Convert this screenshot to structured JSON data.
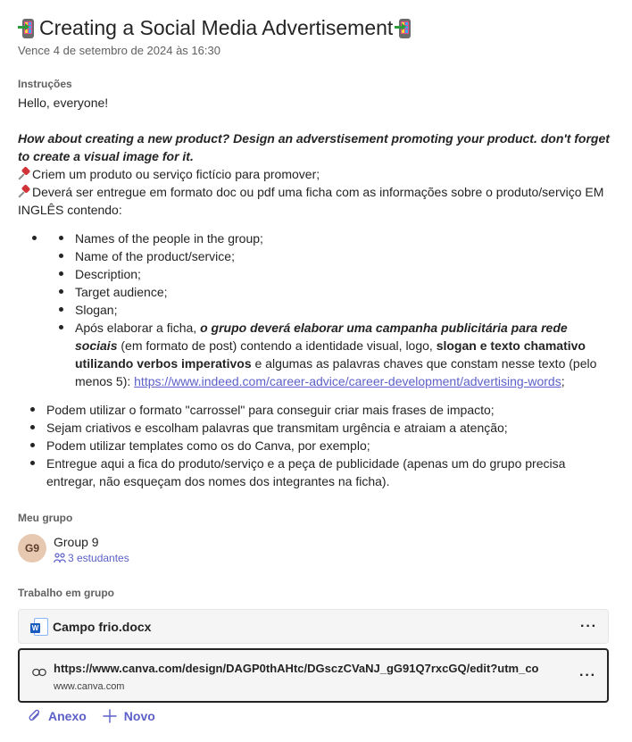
{
  "assignment": {
    "title": "Creating a Social Media Advertisement",
    "due": "Vence 4 de setembro de 2024 às 16:30"
  },
  "instructions": {
    "label": "Instruções",
    "greeting": "Hello, everyone!",
    "prompt": "How about creating a new product? Design an adverstisement promoting your product.  don't forget to create a visual image for it.",
    "pin1": "Criem um produto ou serviço fictício para promover;",
    "pin2": "Deverá ser entregue em formato doc ou pdf uma ficha com as informações sobre o produto/serviço EM INGLÊS contendo:",
    "inner_items": [
      "Names of the people in the group;",
      "Name of the product/service;",
      "Description;",
      "Target audience;",
      "Slogan;"
    ],
    "campaign": {
      "t1": "Após elaborar a ficha, ",
      "t2": "o grupo deverá elaborar uma campanha publicitária para rede sociais",
      "t3": " (em formato de post) contendo a identidade visual, logo, ",
      "t4": "slogan e texto chamativo utilizando verbos imperativos",
      "t5": " e algumas as palavras chaves que constam nesse texto (pelo menos 5): ",
      "link": "https://www.indeed.com/career-advice/career-development/advertising-words",
      "t6": ";"
    },
    "outer_items": [
      "Podem utilizar o formato \"carrossel\" para conseguir criar mais frases de impacto;",
      "Sejam criativos e escolham palavras que transmitam urgência e atraiam a atenção;",
      "Podem utilizar templates como os do Canva, por exemplo;",
      "Entregue aqui a fica do produto/serviço e a peça de publicidade (apenas um do grupo precisa entregar, não esqueçam dos nomes dos integrantes na ficha)."
    ]
  },
  "group": {
    "label": "Meu grupo",
    "initials": "G9",
    "name": "Group 9",
    "members": "3 estudantes"
  },
  "work": {
    "label": "Trabalho em grupo",
    "file_name": "Campo frio.docx",
    "link_url": "https://www.canva.com/design/DAGP0thAHtc/DGsczCVaNJ_gG91Q7rxcGQ/edit?utm_co",
    "link_domain": "www.canva.com",
    "more": "···"
  },
  "actions": {
    "attach": "Anexo",
    "new": "Novo"
  },
  "icons": {
    "title": "mobile-phone-arrow-icon",
    "pin": "pushpin-icon",
    "doc": "word-document-icon",
    "link": "link-icon",
    "people": "people-icon",
    "attach": "paperclip-icon",
    "new": "plus-icon"
  }
}
